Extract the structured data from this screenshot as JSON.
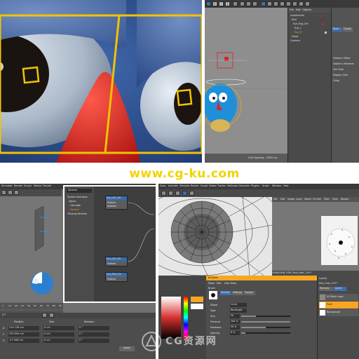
{
  "watermark": {
    "top_url": "www.cg-ku.com",
    "bottom_text": "CG资源网"
  },
  "panel_top_right": {
    "toolbar_axes": [
      "X",
      "Y",
      "Z"
    ],
    "menu": [
      "File",
      "Edit",
      "Objects",
      "Tags",
      "Bookmarks"
    ],
    "objects": [
      "Subdivision",
      "Null",
      "Eye_Rig_Ctrl",
      "Eye_L",
      "Eye_R",
      "Head",
      "Camera"
    ],
    "attr_tabs": [
      "Basic",
      "Coord.",
      "Object"
    ],
    "attr_rows": [
      "Visible in Editor",
      "Visible in Renderer",
      "Use Color",
      "Display Color",
      "X-Ray"
    ],
    "status": "Grid Spacing : 1000 cm"
  },
  "panel_bottom_left": {
    "menu": [
      "Simulate",
      "Render",
      "Sculpt",
      "Motion Tracker"
    ],
    "xpresso_title": "Xpresso",
    "node_list": [
      "System Operators",
      "Adjust",
      "Calculate",
      "General",
      "Thinking Particles"
    ],
    "nodes": [
      {
        "title": "Eye_L00_Ctrl",
        "ports": [
          "Position",
          "Rotation"
        ]
      },
      {
        "title": "Eye_L00_Ctrl",
        "ports": [
          "Position"
        ]
      },
      {
        "title": "Eye_R00_Ctrl",
        "ports": [
          "Position"
        ]
      }
    ],
    "timeline_frames": [
      "0",
      "10",
      "20",
      "30",
      "40",
      "50",
      "60",
      "70",
      "80",
      "90"
    ],
    "coord_headers": [
      "Position",
      "Size",
      "Rotation"
    ],
    "coord_rows": [
      {
        "label": "X",
        "pos": "214.738 cm",
        "size": "0 cm",
        "rot": "0 °"
      },
      {
        "label": "Y",
        "pos": "255.994 cm",
        "size": "0 cm",
        "rot": "0 °"
      },
      {
        "label": "Z",
        "pos": "-27.946 cm",
        "size": "0 cm",
        "rot": "0 °"
      }
    ],
    "frame_field": "0 F",
    "apply_button": "Apply"
  },
  "panel_bottom_right": {
    "menu": [
      "Snap",
      "Animate",
      "Simulate",
      "Render",
      "Sculpt",
      "Motion Tracker",
      "MoGraph",
      "Character",
      "Plugins",
      "Script",
      "Window",
      "Help"
    ],
    "uv_menu": [
      "File",
      "Edit",
      "Image",
      "Layer",
      "Select",
      "UV Edit",
      "Filter",
      "View",
      "Render"
    ],
    "status": "Zoom: 9.2%, Size: 2048x2048, 8 Bit, Bad_Color_1.tif *",
    "attr_header": "Brushes",
    "attr_tabs": [
      "Mode",
      "Edit",
      "User Data"
    ],
    "brush_label": "Brush",
    "brush_tabs": [
      "Preview",
      "Settings",
      "Presets"
    ],
    "brush_fields": [
      {
        "label": "Shape",
        "value": "Circle"
      },
      {
        "label": "Type",
        "value": "Rectangle"
      },
      {
        "label": "Size",
        "value": "50"
      },
      {
        "label": "Pressure",
        "value": "100 %"
      },
      {
        "label": "Hardness",
        "value": "50 %"
      },
      {
        "label": "Spacing",
        "value": "8 %"
      }
    ],
    "layers_header": "Layers",
    "layers_menu": [
      "Mat_Color_1.tif *"
    ],
    "layers_tabs": [
      "Textures",
      "Layers"
    ],
    "layers": [
      "UV Mesh Layer",
      "Paint",
      "Background"
    ],
    "colors": {
      "accent": "#f5a623",
      "highlight": "#3d6fb5"
    }
  }
}
